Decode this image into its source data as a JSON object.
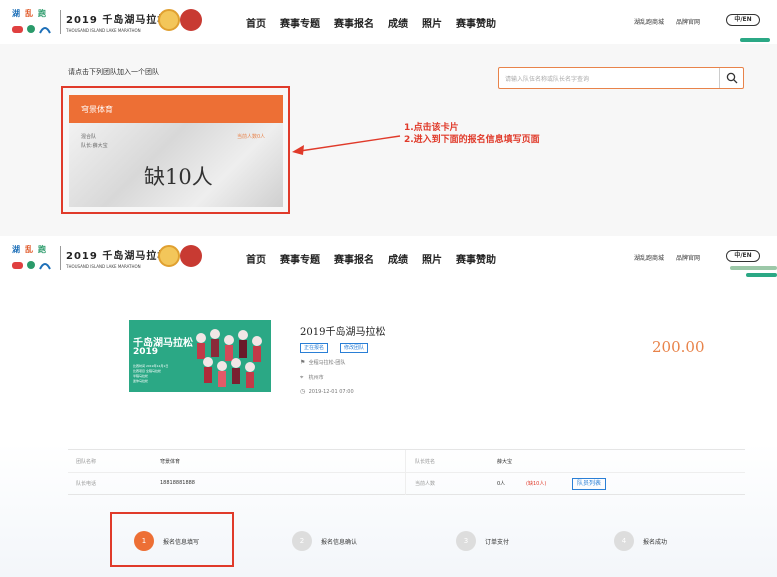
{
  "header": {
    "brand_title": "2019 千岛湖马拉松",
    "brand_subtitle": "THOUSAND ISLAND LAKE MARATHON",
    "logo_glyphs": [
      "湖",
      "乱",
      "跑"
    ],
    "nav": [
      "首页",
      "赛事专题",
      "赛事报名",
      "成绩",
      "照片",
      "赛事赞助"
    ],
    "right_nav": [
      "湖乱跑商城",
      "品牌官网"
    ],
    "lang": "中/EN"
  },
  "team_select": {
    "hint": "请点击下列团队加入一个团队",
    "search_placeholder": "请输入队伍名称或队长名字查询",
    "card": {
      "name": "穹景体育",
      "type": "混合队",
      "leader": "队长:薛大宝",
      "current": "当前人数0人",
      "shortage": "缺10人"
    }
  },
  "annotation": {
    "line1": "1.点击该卡片",
    "line2": "2.进入到下面的报名信息填写页面"
  },
  "event": {
    "poster_title": "千岛湖马拉松",
    "poster_year": "2019",
    "poster_small": [
      "比赛时间 2019年12月1日",
      "比赛项目 全程马拉松",
      "半程马拉松",
      "迷你马拉松"
    ],
    "title": "2019千岛湖马拉松",
    "tags": [
      "正在报名",
      "修改团队"
    ],
    "category": "全程马拉松-团队",
    "city": "杭州市",
    "time": "2019-12-01 07:00",
    "price": "200.00"
  },
  "team_info": {
    "team_name_label": "团队名称",
    "team_name": "穹景体育",
    "leader_name_label": "队长姓名",
    "leader_name": "薛大宝",
    "leader_phone_label": "队长电话",
    "leader_phone": "18818881888",
    "count_label": "当前人数",
    "count": "0人",
    "shortage": "(缺10人)",
    "member_list_btn": "队员列表"
  },
  "steps": [
    {
      "num": "1",
      "label": "报名信息填写"
    },
    {
      "num": "2",
      "label": "报名信息确认"
    },
    {
      "num": "3",
      "label": "订单支付"
    },
    {
      "num": "4",
      "label": "报名成功"
    }
  ],
  "colors": {
    "accent": "#ed6f35",
    "annotation_red": "#e03a2a",
    "link_blue": "#2a7fd6",
    "poster_green": "#2ba885"
  }
}
